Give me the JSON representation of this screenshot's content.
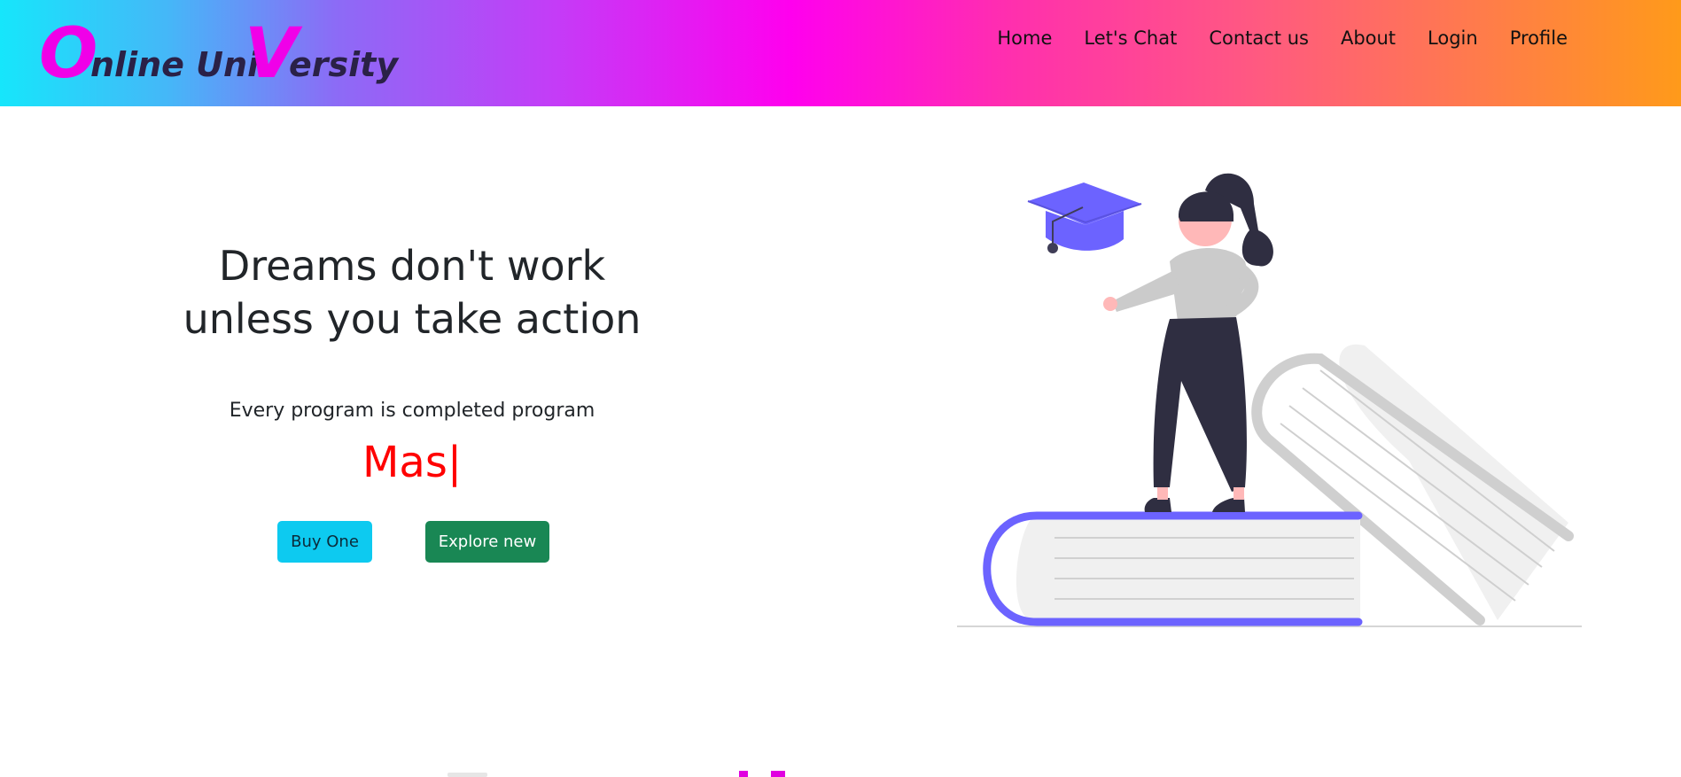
{
  "brand": {
    "letter_o": "O",
    "text_1": "nline Uni",
    "letter_v": "V",
    "text_2": "ersity"
  },
  "nav": {
    "items": [
      {
        "label": "Home"
      },
      {
        "label": "Let's Chat"
      },
      {
        "label": "Contact us"
      },
      {
        "label": "About"
      },
      {
        "label": "Login"
      },
      {
        "label": "Profile"
      }
    ]
  },
  "hero": {
    "title_line1": "Dreams don't work",
    "title_line2": "unless you take action",
    "subtitle": "Every program is completed program",
    "typed_text": "Mas|",
    "buy_label": "Buy One",
    "explore_label": "Explore new"
  },
  "colors": {
    "accent_magenta": "#f000e8",
    "typed_red": "#ff0000",
    "button_info": "#0dcaf0",
    "button_success": "#198754",
    "illustration_purple": "#6c63ff"
  },
  "icons": {
    "illustration": "graduate-woman-on-books-illustration"
  }
}
